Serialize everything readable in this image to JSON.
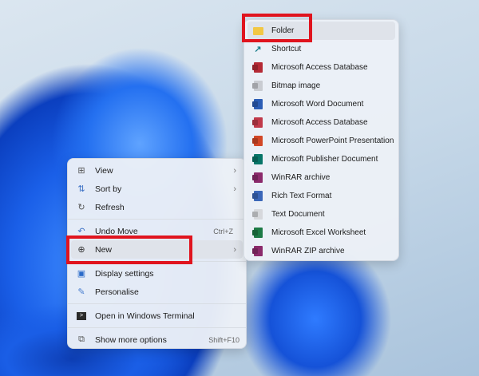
{
  "context_menu": {
    "items": [
      {
        "label": "View",
        "icon": "view-grid-icon",
        "submenu": true
      },
      {
        "label": "Sort by",
        "icon": "sort-icon",
        "submenu": true
      },
      {
        "label": "Refresh",
        "icon": "refresh-icon"
      },
      {
        "label": "Undo Move",
        "icon": "undo-icon",
        "shortcut": "Ctrl+Z"
      },
      {
        "label": "New",
        "icon": "plus-circle-icon",
        "submenu": true
      },
      {
        "label": "Display settings",
        "icon": "display-icon"
      },
      {
        "label": "Personalise",
        "icon": "brush-icon"
      },
      {
        "label": "Open in Windows Terminal",
        "icon": "terminal-icon"
      },
      {
        "label": "Show more options",
        "icon": "more-options-icon",
        "shortcut": "Shift+F10"
      }
    ]
  },
  "new_submenu": {
    "items": [
      {
        "label": "Folder",
        "icon": "folder-icon",
        "color": "#f2c744"
      },
      {
        "label": "Shortcut",
        "icon": "shortcut-arrow-icon",
        "color": "#1a7f8c"
      },
      {
        "label": "Microsoft Access Database",
        "icon": "access-icon",
        "color": "#b52a35"
      },
      {
        "label": "Bitmap image",
        "icon": "bitmap-icon",
        "color": "#c9ccd2"
      },
      {
        "label": "Microsoft Word Document",
        "icon": "word-icon",
        "color": "#2b5db5"
      },
      {
        "label": "Microsoft Access Database",
        "icon": "access-icon",
        "color": "#c0394a"
      },
      {
        "label": "Microsoft PowerPoint Presentation",
        "icon": "powerpoint-icon",
        "color": "#d24726"
      },
      {
        "label": "Microsoft Publisher Document",
        "icon": "publisher-icon",
        "color": "#077568"
      },
      {
        "label": "WinRAR archive",
        "icon": "winrar-icon",
        "color": "#8b2a6b"
      },
      {
        "label": "Rich Text Format",
        "icon": "rtf-icon",
        "color": "#3a66b8"
      },
      {
        "label": "Text Document",
        "icon": "text-document-icon",
        "color": "#d6d8dc"
      },
      {
        "label": "Microsoft Excel Worksheet",
        "icon": "excel-icon",
        "color": "#1d7a45"
      },
      {
        "label": "WinRAR ZIP archive",
        "icon": "winrar-zip-icon",
        "color": "#8b2a6b"
      }
    ]
  },
  "highlight_color": "#e0141e"
}
